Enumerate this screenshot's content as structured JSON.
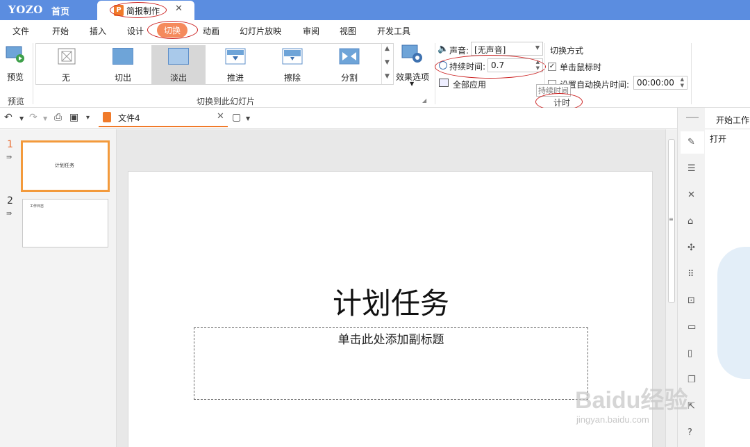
{
  "app": {
    "brand": "YOZO",
    "home_tab": "首页",
    "doc_tab": "简报制作"
  },
  "menu": [
    "文件",
    "开始",
    "插入",
    "设计",
    "切换",
    "动画",
    "幻灯片放映",
    "审阅",
    "视图",
    "开发工具"
  ],
  "ribbon": {
    "preview_label": "预览",
    "preview_group": "预览",
    "gallery_group": "切换到此幻灯片",
    "gallery": [
      "无",
      "切出",
      "淡出",
      "推进",
      "擦除",
      "分割"
    ],
    "effect_options": "效果选项",
    "sound_label": "声音:",
    "sound_value": "[无声音]",
    "duration_label": "持续时间:",
    "duration_value": "0.7",
    "apply_all": "全部应用",
    "switch_mode": "切换方式",
    "on_click": "单击鼠标时",
    "auto_advance": "设置自动换片时间:",
    "auto_time": "00:00:00",
    "tooltip": "持续时间",
    "timing_group": "计时"
  },
  "document": {
    "tab_label": "文件4"
  },
  "slides": [
    {
      "number": "1",
      "title": "计划任务"
    },
    {
      "number": "2",
      "title": "工作日志"
    }
  ],
  "editor": {
    "title": "计划任务",
    "subtitle_placeholder": "单击此处添加副标题"
  },
  "right_panel": {
    "title": "开始工作",
    "open": "打开"
  },
  "watermark": {
    "logo": "Baidu经验",
    "url": "jingyan.baidu.com"
  },
  "colors": {
    "titlebar": "#5b8de0",
    "accent": "#f58a5c",
    "selection_border": "#f39a3c",
    "annotation": "#cc2222"
  }
}
